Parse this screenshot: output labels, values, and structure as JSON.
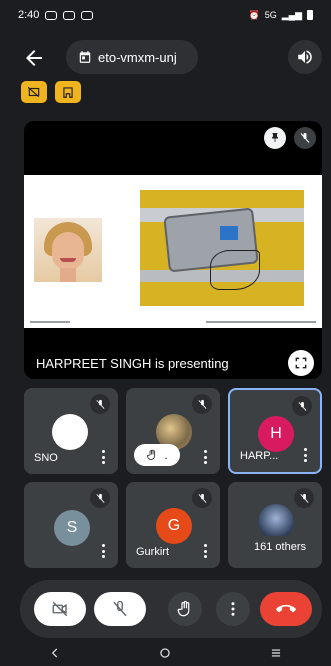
{
  "status_bar": {
    "time": "2:40",
    "right_text": "5G"
  },
  "header": {
    "meeting_code": "eto-vmxm-unj"
  },
  "presentation": {
    "presenting_text": "HARPREET SINGH is presenting"
  },
  "participants": [
    {
      "name": "SNO",
      "initial": "",
      "avatar_color": "#ffffff"
    },
    {
      "name": "",
      "initial": "",
      "avatar_color": "#cfd8dc",
      "hand_text": "."
    },
    {
      "name": "HARP...",
      "initial": "H",
      "avatar_color": "#d81b60"
    },
    {
      "name": "",
      "initial": "S",
      "avatar_color": "#78909c"
    },
    {
      "name": "Gurkirt",
      "initial": "G",
      "avatar_color": "#e64a19"
    },
    {
      "name": "",
      "initial": "",
      "avatar_color": "#455a64",
      "others_text": "161 others"
    }
  ],
  "colors": {
    "chip_yellow": "#f0b41f",
    "end_call_red": "#ea4335",
    "active_border": "#8ab4f8"
  },
  "icons": [
    "back-arrow-icon",
    "calendar-icon",
    "speaker-icon",
    "pin-icon",
    "mic-off-icon",
    "expand-icon",
    "raise-hand-icon",
    "more-options-icon",
    "camera-off-icon",
    "end-call-icon"
  ]
}
